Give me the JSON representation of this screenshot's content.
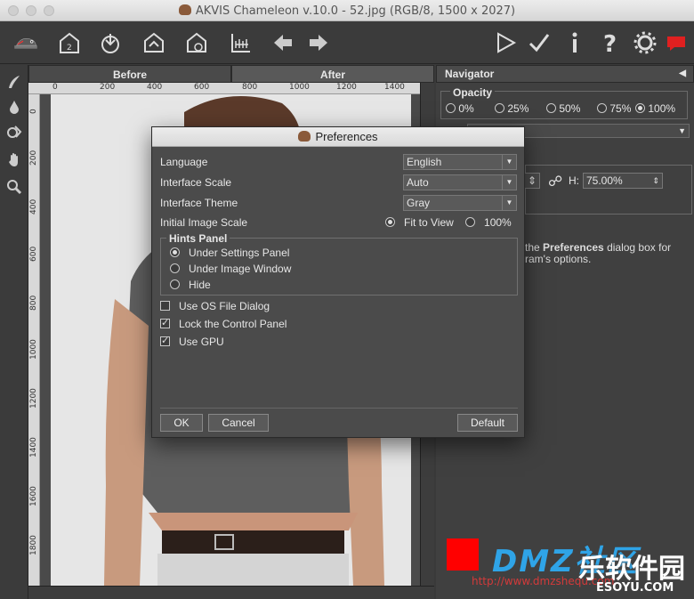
{
  "window": {
    "title": "AKVIS Chameleon v.10.0 - 52.jpg (RGB/8, 1500 x 2027)"
  },
  "toolbar": {
    "icons": [
      "logo-icon",
      "new-file-icon",
      "open-file-icon",
      "save-file-icon",
      "print-icon",
      "share-icon",
      "ruler-grid-icon",
      "undo-arrow-icon",
      "redo-arrow-icon",
      "run-icon",
      "apply-icon",
      "info-icon",
      "help-icon",
      "settings-icon",
      "feedback-icon"
    ]
  },
  "tools": [
    "brush-tool-icon",
    "drop-tool-icon",
    "eraser-tool-icon",
    "hand-tool-icon",
    "zoom-tool-icon"
  ],
  "view_tabs": {
    "before": "Before",
    "after": "After"
  },
  "ruler": {
    "top_ticks": [
      "0",
      "200",
      "400",
      "600",
      "800",
      "1000",
      "1200",
      "1400"
    ],
    "left_ticks": [
      "0",
      "200",
      "400",
      "600",
      "800",
      "1000",
      "1200",
      "1400",
      "1600",
      "1800"
    ]
  },
  "navigator": {
    "title": "Navigator",
    "opacity": {
      "label": "Opacity",
      "options": [
        "0%",
        "25%",
        "50%",
        "75%",
        "100%"
      ],
      "selected": "100%"
    },
    "height_label": "H:",
    "height_value": "75.00%",
    "help_prefix": "the ",
    "help_bold": "Preferences",
    "help_suffix": " dialog box for",
    "help_line2": "ram's options."
  },
  "preferences": {
    "title": "Preferences",
    "language_label": "Language",
    "language_value": "English",
    "interface_scale_label": "Interface Scale",
    "interface_scale_value": "Auto",
    "interface_theme_label": "Interface Theme",
    "interface_theme_value": "Gray",
    "initial_scale_label": "Initial Image Scale",
    "initial_scale_options": [
      "Fit to View",
      "100%"
    ],
    "initial_scale_selected": "Fit to View",
    "hints_panel": {
      "title": "Hints Panel",
      "options": [
        "Under Settings Panel",
        "Under Image Window",
        "Hide"
      ],
      "selected": "Under Settings Panel"
    },
    "checkboxes": [
      {
        "label": "Use OS File Dialog",
        "checked": false
      },
      {
        "label": "Lock the Control Panel",
        "checked": true
      },
      {
        "label": "Use GPU",
        "checked": true
      }
    ],
    "ok_label": "OK",
    "cancel_label": "Cancel",
    "default_label": "Default"
  },
  "watermark": {
    "brand": "DMZ",
    "chinese": "社区",
    "url1": "http://www.dmzshequ.com",
    "url2": "ESOYU.COM",
    "site": "乐软件园"
  },
  "colors": {
    "bg": "#3a3a3a",
    "panel": "#404040",
    "accent_red": "#e02020",
    "watermark_blue": "#2fa4e7"
  }
}
